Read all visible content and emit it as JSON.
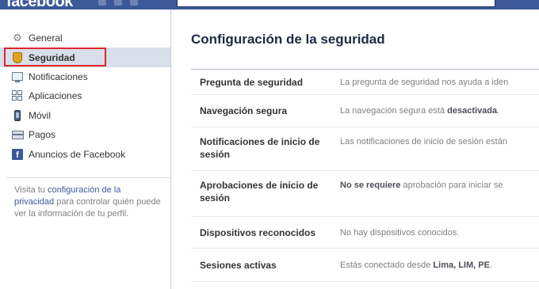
{
  "header": {
    "logo": "facebook"
  },
  "sidebar": {
    "items": [
      {
        "label": "General",
        "icon": "gears-icon",
        "selected": false
      },
      {
        "label": "Seguridad",
        "icon": "shield-icon",
        "selected": true
      },
      {
        "label": "Notificaciones",
        "icon": "monitor-icon",
        "selected": false
      },
      {
        "label": "Aplicaciones",
        "icon": "apps-icon",
        "selected": false
      },
      {
        "label": "Móvil",
        "icon": "mobile-phone-icon",
        "selected": false
      },
      {
        "label": "Pagos",
        "icon": "credit-card-icon",
        "selected": false
      },
      {
        "label": "Anuncios de Facebook",
        "icon": "facebook-ads-icon",
        "selected": false
      }
    ],
    "privacy_note": {
      "prefix": "Visita tu ",
      "link": "configuración de la privacidad",
      "suffix": " para controlar quién puede ver la información de tu perfil."
    }
  },
  "main": {
    "title": "Configuración de la seguridad",
    "settings": [
      {
        "label": "Pregunta de seguridad",
        "value_parts": [
          {
            "text": "La pregunta de seguridad nos ayuda a iden",
            "bold": false
          }
        ]
      },
      {
        "label": "Navegación segura",
        "value_parts": [
          {
            "text": "La navegación segura está ",
            "bold": false
          },
          {
            "text": "desactivada",
            "bold": true
          },
          {
            "text": ".",
            "bold": false
          }
        ]
      },
      {
        "label": "Notificaciones de inicio de sesión",
        "value_parts": [
          {
            "text": "Las notificaciones de inicio de sesión están",
            "bold": false
          }
        ]
      },
      {
        "label": "Aprobaciones de inicio de sesión",
        "value_parts": [
          {
            "text": "No se requiere",
            "bold": true
          },
          {
            "text": " aprobación para iniciar se",
            "bold": false
          }
        ]
      },
      {
        "label": "Dispositivos reconocidos",
        "value_parts": [
          {
            "text": "No hay dispositivos conocidos.",
            "bold": false
          }
        ]
      },
      {
        "label": "Sesiones activas",
        "value_parts": [
          {
            "text": "Estás conectado desde ",
            "bold": false
          },
          {
            "text": "Lima, LIM, PE",
            "bold": true
          },
          {
            "text": ".",
            "bold": false
          }
        ]
      }
    ]
  },
  "colors": {
    "brand_blue": "#3b5998",
    "selected_bg": "#d8dfea",
    "highlight_red": "#e0262b",
    "title_color": "#1c2a47"
  }
}
